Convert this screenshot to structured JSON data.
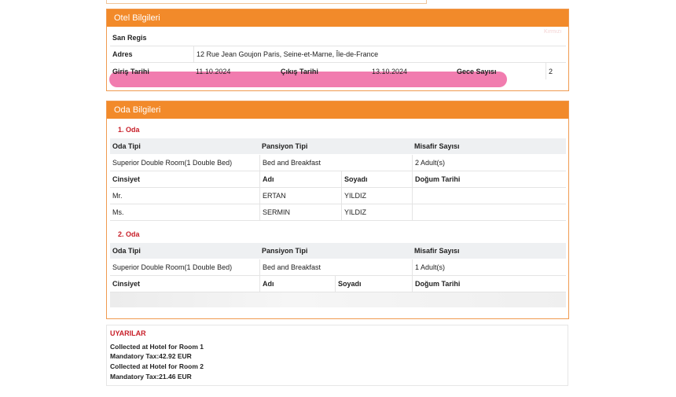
{
  "hotel": {
    "heading": "Otel Bilgileri",
    "name": "San Regis",
    "corner_note": "Kırmızı",
    "address_label": "Adres",
    "address": "12 Rue Jean Goujon Paris, Seine-et-Marne, Île-de-France",
    "checkin_label": "Giriş Tarihi",
    "checkin": "11.10.2024",
    "checkout_label": "Çıkış Tarihi",
    "checkout": "13.10.2024",
    "nights_label": "Gece Sayısı",
    "nights": "2"
  },
  "rooms": {
    "heading": "Oda Bilgileri",
    "headers": {
      "room_type": "Oda Tipi",
      "board": "Pansiyon Tipi",
      "guests": "Misafir Sayısı",
      "gender": "Cinsiyet",
      "first": "Adı",
      "last": "Soyadı",
      "dob": "Doğum Tarihi"
    },
    "list": [
      {
        "title": "1. Oda",
        "room_type": "Superior Double Room(1 Double Bed)",
        "board": "Bed and Breakfast",
        "guests": "2 Adult(s)",
        "people": [
          {
            "gender": "Mr.",
            "first": "ERTAN",
            "last": "YILDIZ",
            "dob": ""
          },
          {
            "gender": "Ms.",
            "first": "SERMIN",
            "last": "YILDIZ",
            "dob": ""
          }
        ]
      },
      {
        "title": "2. Oda",
        "room_type": "Superior Double Room(1 Double Bed)",
        "board": "Bed and Breakfast",
        "guests": "1 Adult(s)",
        "people": []
      }
    ]
  },
  "warnings": {
    "title": "UYARILAR",
    "lines": [
      "Collected at Hotel for Room 1",
      "Mandatory Tax:42.92 EUR",
      "Collected at Hotel for Room 2",
      "Mandatory Tax:21.46 EUR"
    ]
  },
  "colors": {
    "header_orange": "#f28a2a",
    "warning_red": "#c8202a",
    "highlight_pink": "#ef6ea6"
  }
}
